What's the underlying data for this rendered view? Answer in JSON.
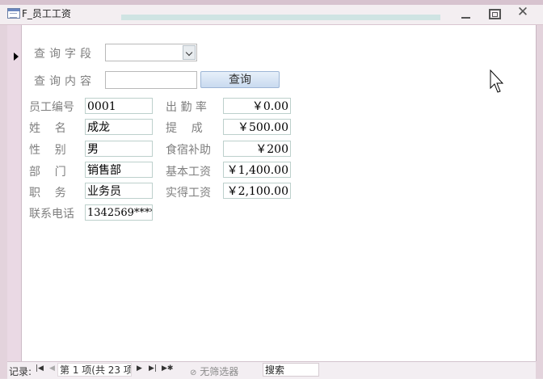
{
  "window": {
    "title": "F_员工工资",
    "icon": "form-icon",
    "controls": [
      "minimize-icon",
      "restore-icon",
      "close-icon"
    ]
  },
  "search": {
    "field_label": "查询字段",
    "field_value": "",
    "content_label": "查询内容",
    "content_value": "",
    "button_label": "查询"
  },
  "fields_left": [
    {
      "label": "员工编号",
      "value": "0001"
    },
    {
      "label": "姓    名",
      "value": "成龙"
    },
    {
      "label": "性    别",
      "value": "男"
    },
    {
      "label": "部    门",
      "value": "销售部"
    },
    {
      "label": "职    务",
      "value": "业务员"
    },
    {
      "label": "联系电话",
      "value": "1342569****"
    }
  ],
  "fields_right": [
    {
      "label": "出 勤 率",
      "value": "￥0.00"
    },
    {
      "label": "提    成",
      "value": "￥500.00"
    },
    {
      "label": "食宿补助",
      "value": "￥200"
    },
    {
      "label": "基本工资",
      "value": "￥1,400.00"
    },
    {
      "label": "实得工资",
      "value": "￥2,100.00"
    }
  ],
  "navigation": {
    "records_label": "记录:",
    "current": "第 1 项(共 23 项",
    "filter_label": "无筛选器",
    "search_label": "搜索"
  },
  "colors": {
    "label_text": "#7f7f7f",
    "field_border": "#bdd0cc",
    "window_frame": "#e3d3dc"
  }
}
